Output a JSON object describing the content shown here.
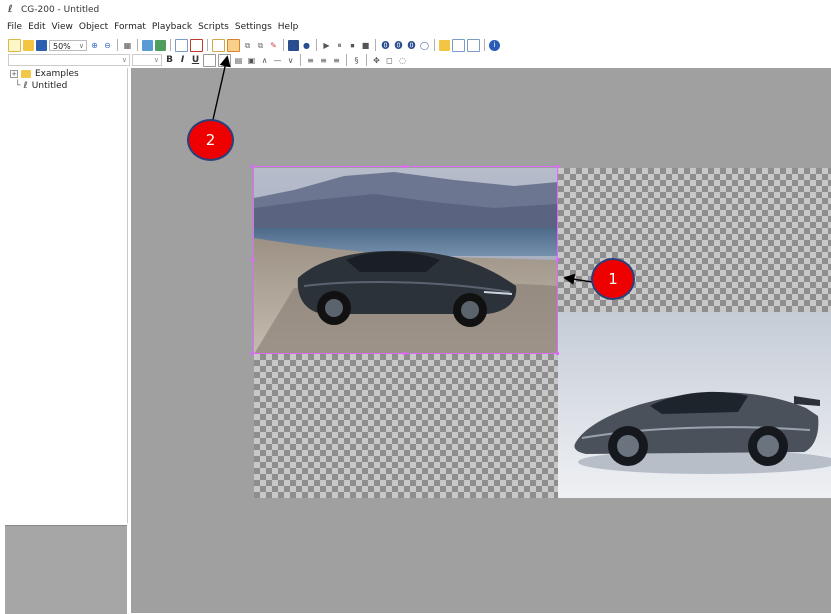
{
  "window": {
    "title": "CG-200 - Untitled"
  },
  "menu": [
    "File",
    "Edit",
    "View",
    "Object",
    "Format",
    "Playback",
    "Scripts",
    "Settings",
    "Help"
  ],
  "toolbar": {
    "zoom": "50%"
  },
  "format_bar": {
    "bold": "B",
    "italic": "I",
    "underline": "U"
  },
  "tree": {
    "items": [
      {
        "label": "Examples"
      },
      {
        "label": "Untitled"
      }
    ]
  },
  "callouts": {
    "one": "1",
    "two": "2"
  },
  "colors": {
    "callout": "#ee0000",
    "selection": "#e066ff",
    "canvas": "#a0a0a0"
  }
}
